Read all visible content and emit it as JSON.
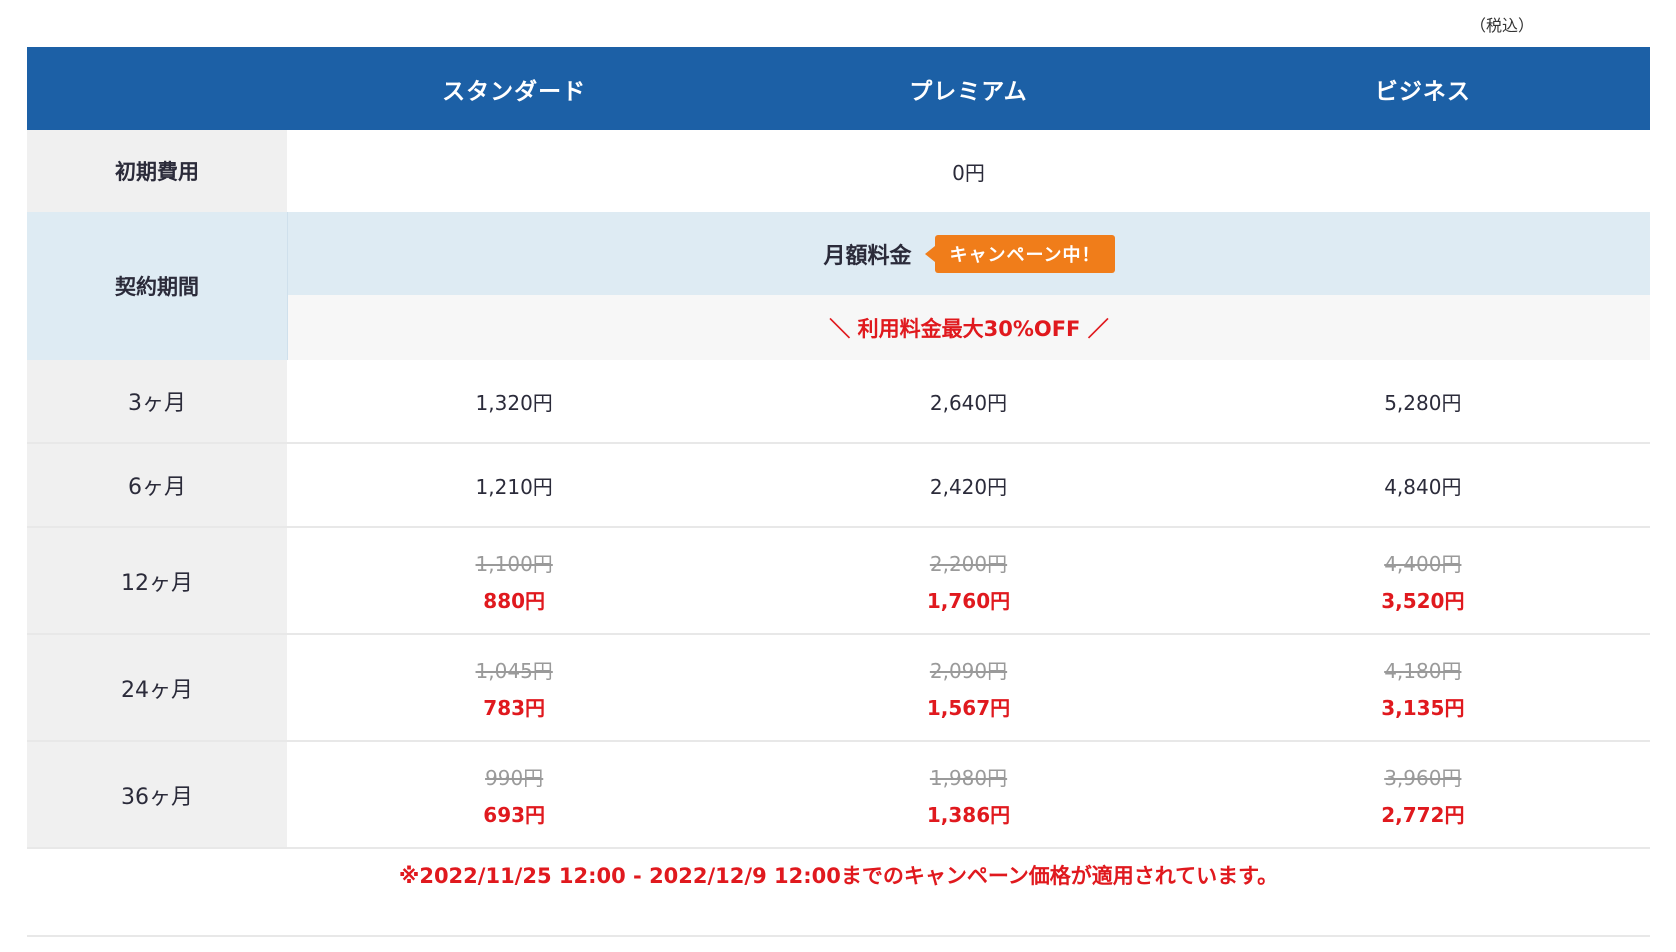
{
  "tax_note": "（税込）",
  "plans": [
    "スタンダード",
    "プレミアム",
    "ビジネス"
  ],
  "initial_fee": {
    "label": "初期費用",
    "value": "0円"
  },
  "contract": {
    "label": "契約期間",
    "monthly_label": "月額料金",
    "campaign_badge": "キャンペーン中！",
    "discount_banner": "＼ 利用料金最大30%OFF ／"
  },
  "rows": [
    {
      "period": "3ヶ月",
      "prices": [
        {
          "regular": "1,320円"
        },
        {
          "regular": "2,640円"
        },
        {
          "regular": "5,280円"
        }
      ]
    },
    {
      "period": "6ヶ月",
      "prices": [
        {
          "regular": "1,210円"
        },
        {
          "regular": "2,420円"
        },
        {
          "regular": "4,840円"
        }
      ]
    },
    {
      "period": "12ヶ月",
      "prices": [
        {
          "old": "1,100円",
          "new": "880円"
        },
        {
          "old": "2,200円",
          "new": "1,760円"
        },
        {
          "old": "4,400円",
          "new": "3,520円"
        }
      ]
    },
    {
      "period": "24ヶ月",
      "prices": [
        {
          "old": "1,045円",
          "new": "783円"
        },
        {
          "old": "2,090円",
          "new": "1,567円"
        },
        {
          "old": "4,180円",
          "new": "3,135円"
        }
      ]
    },
    {
      "period": "36ヶ月",
      "prices": [
        {
          "old": "990円",
          "new": "693円"
        },
        {
          "old": "1,980円",
          "new": "1,386円"
        },
        {
          "old": "3,960円",
          "new": "2,772円"
        }
      ]
    }
  ],
  "footnote": "※2022/11/25 12:00 - 2022/12/9 12:00までのキャンペーン価格が適用されています。",
  "colors": {
    "header_bg": "#1c60a6",
    "accent_red": "#e0191e",
    "badge_orange": "#f07d1a",
    "label_bg": "#f0f0f0",
    "contract_bg": "#deebf3"
  }
}
